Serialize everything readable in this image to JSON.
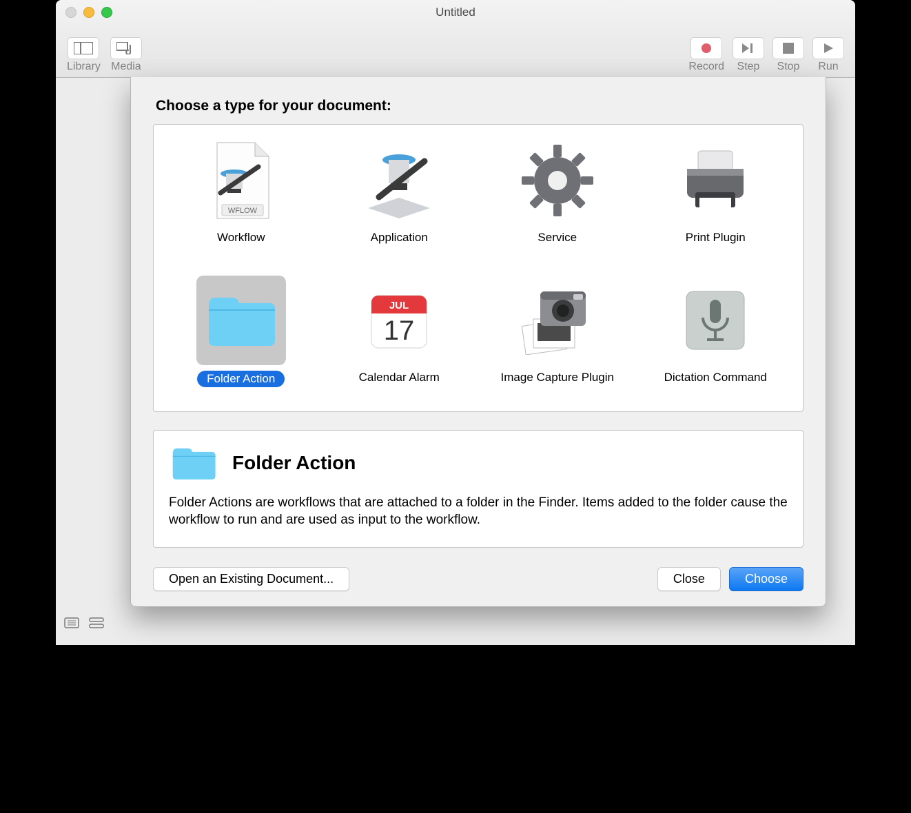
{
  "window": {
    "title": "Untitled"
  },
  "toolbar": {
    "left": [
      {
        "id": "library",
        "label": "Library"
      },
      {
        "id": "media",
        "label": "Media"
      }
    ],
    "right": [
      {
        "id": "record",
        "label": "Record"
      },
      {
        "id": "step",
        "label": "Step"
      },
      {
        "id": "stop",
        "label": "Stop"
      },
      {
        "id": "run",
        "label": "Run"
      }
    ]
  },
  "sheet": {
    "heading": "Choose a type for your document:",
    "items": [
      {
        "id": "workflow",
        "label": "Workflow",
        "selected": false
      },
      {
        "id": "application",
        "label": "Application",
        "selected": false
      },
      {
        "id": "service",
        "label": "Service",
        "selected": false
      },
      {
        "id": "print-plugin",
        "label": "Print Plugin",
        "selected": false
      },
      {
        "id": "folder-action",
        "label": "Folder Action",
        "selected": true
      },
      {
        "id": "calendar-alarm",
        "label": "Calendar Alarm",
        "selected": false
      },
      {
        "id": "image-capture-plugin",
        "label": "Image Capture Plugin",
        "selected": false
      },
      {
        "id": "dictation-command",
        "label": "Dictation Command",
        "selected": false
      }
    ],
    "calendar": {
      "month": "JUL",
      "day": "17"
    },
    "info": {
      "title": "Folder Action",
      "desc": "Folder Actions are workflows that are attached to a folder in the Finder. Items added to the folder cause the workflow to run and are used as input to the workflow."
    },
    "buttons": {
      "open": "Open an Existing Document...",
      "close": "Close",
      "choose": "Choose"
    }
  },
  "workflow_badge": "WFLOW"
}
